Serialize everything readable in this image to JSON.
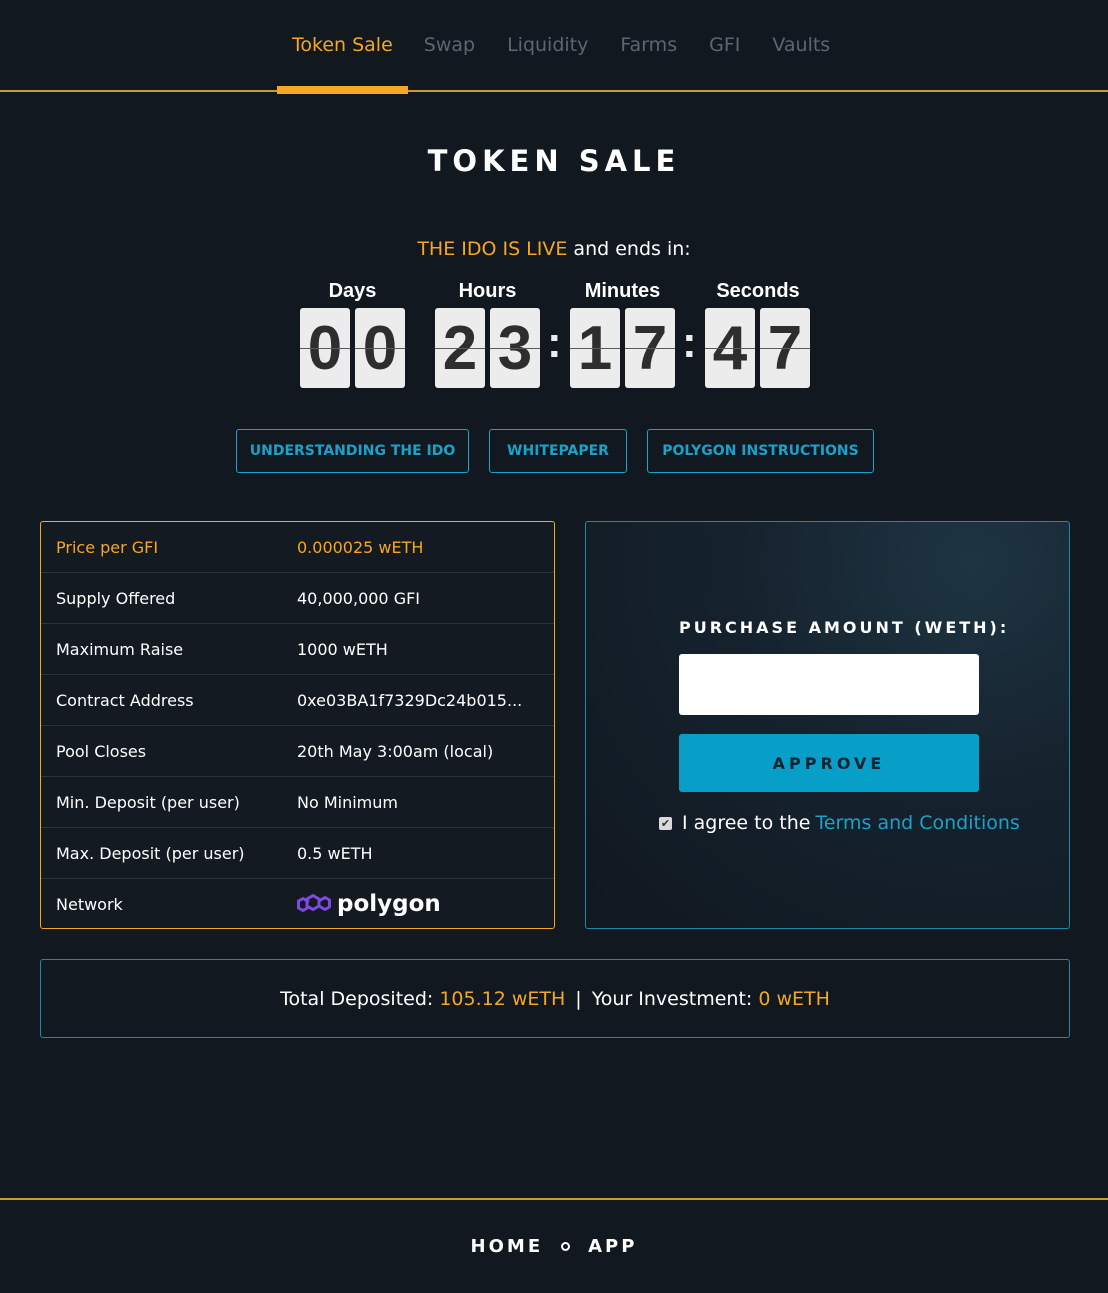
{
  "nav": {
    "tabs": [
      "Token Sale",
      "Swap",
      "Liquidity",
      "Farms",
      "GFI",
      "Vaults"
    ],
    "active": "Token Sale"
  },
  "title": "TOKEN SALE",
  "status": {
    "live": "THE IDO IS LIVE",
    "suffix": "and ends in:"
  },
  "countdown": {
    "days_label": "Days",
    "hours_label": "Hours",
    "minutes_label": "Minutes",
    "seconds_label": "Seconds",
    "d1": "0",
    "d2": "0",
    "h1": "2",
    "h2": "3",
    "m1": "1",
    "m2": "7",
    "s1": "4",
    "s2": "7"
  },
  "links": {
    "understanding": "UNDERSTANDING THE IDO",
    "whitepaper": "WHITEPAPER",
    "polygon": "POLYGON INSTRUCTIONS"
  },
  "info": [
    {
      "key": "Price per GFI",
      "value": "0.000025 wETH"
    },
    {
      "key": "Supply Offered",
      "value": "40,000,000 GFI"
    },
    {
      "key": "Maximum Raise",
      "value": "1000 wETH"
    },
    {
      "key": "Contract Address",
      "value": "0xe03BA1f7329Dc24b015..."
    },
    {
      "key": "Pool Closes",
      "value": "20th May 3:00am (local)"
    },
    {
      "key": "Min. Deposit (per user)",
      "value": "No Minimum"
    },
    {
      "key": "Max. Deposit (per user)",
      "value": "0.5 wETH"
    },
    {
      "key": "Network",
      "value": "polygon"
    }
  ],
  "purchase": {
    "label": "PURCHASE AMOUNT (WETH):",
    "value": "",
    "approve": "APPROVE",
    "agree_text": "I agree to the",
    "terms": "Terms and Conditions",
    "checked": true
  },
  "totals": {
    "deposited_label": "Total Deposited:",
    "deposited": "105.12 wETH",
    "separator": "|",
    "investment_label": "Your Investment:",
    "investment": "0 wETH"
  },
  "footer": {
    "home": "HOME",
    "app": "APP"
  },
  "colors": {
    "accent": "#f5a623",
    "link": "#1aa3c8",
    "background": "#111820",
    "button": "#079ec8"
  }
}
